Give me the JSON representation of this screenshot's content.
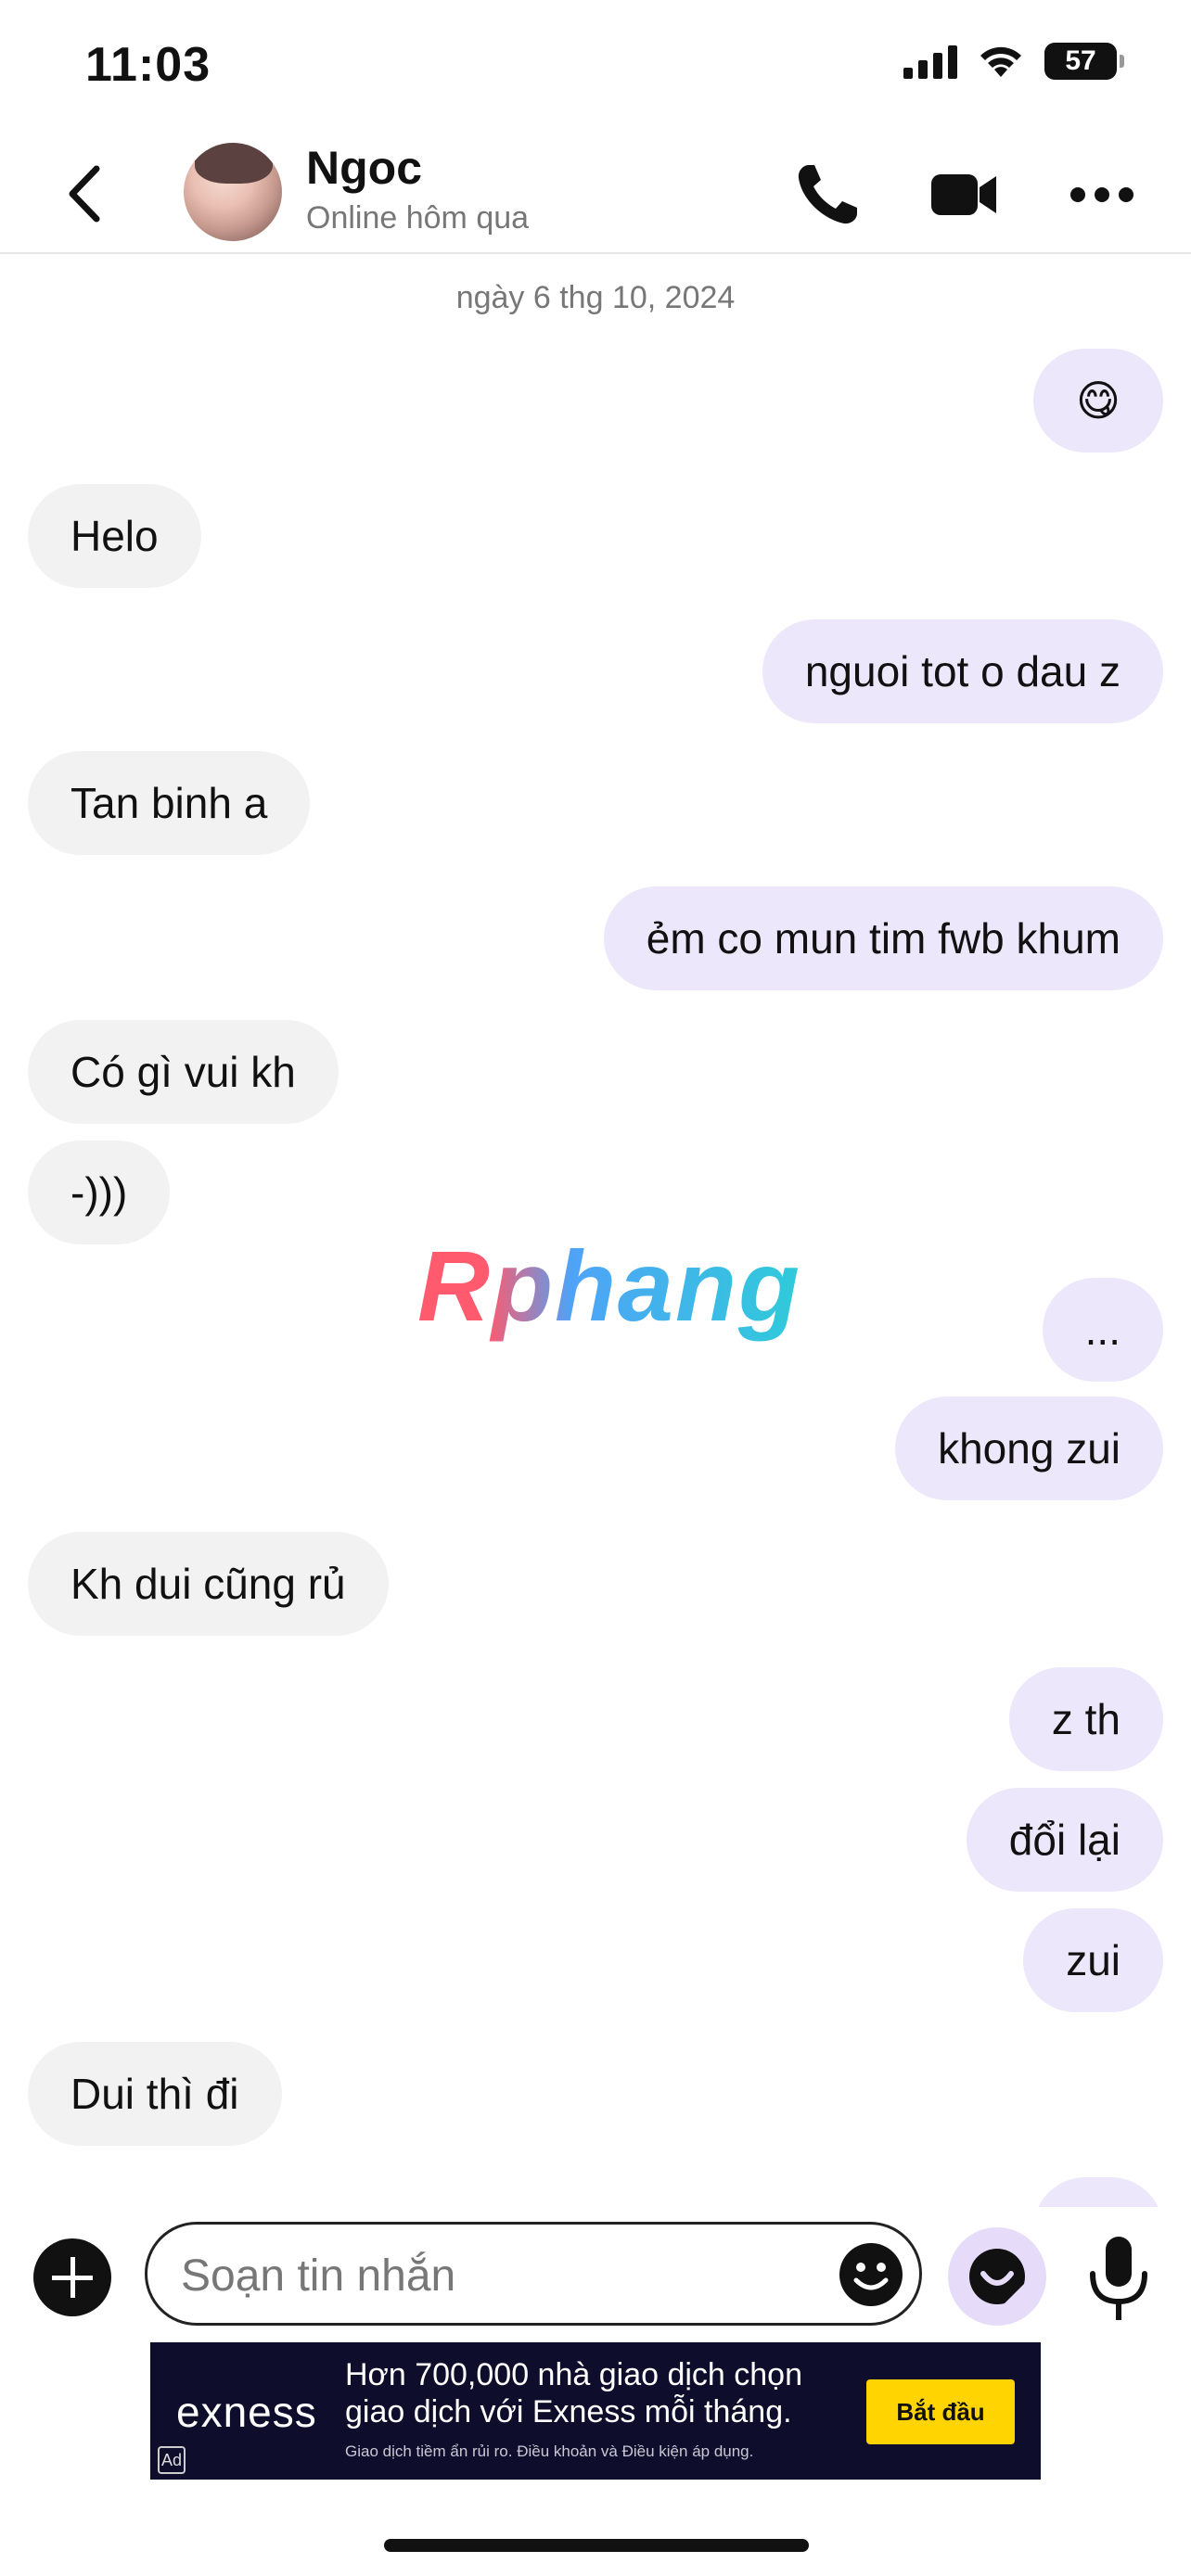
{
  "status_bar": {
    "time": "11:03",
    "battery": "57"
  },
  "header": {
    "contact_name": "Ngoc",
    "contact_status": "Online hôm qua"
  },
  "chat": {
    "date_separator": "ngày 6 thg 10, 2024",
    "messages": [
      {
        "from": "me",
        "text": "😋"
      },
      {
        "from": "them",
        "text": "Helo"
      },
      {
        "from": "me",
        "text": "nguoi tot o dau z"
      },
      {
        "from": "them",
        "text": "Tan binh a"
      },
      {
        "from": "me",
        "text": "ẻm co mun tim fwb khum"
      },
      {
        "from": "them",
        "text": "Có gì vui kh"
      },
      {
        "from": "them",
        "text": "-)))"
      },
      {
        "from": "me",
        "text": "..."
      },
      {
        "from": "me",
        "text": "khong zui"
      },
      {
        "from": "them",
        "text": "Kh dui cũng rủ"
      },
      {
        "from": "me",
        "text": "z th"
      },
      {
        "from": "me",
        "text": "đổi lại"
      },
      {
        "from": "me",
        "text": "zui"
      },
      {
        "from": "them",
        "text": "Dui thì đi"
      }
    ],
    "watermark": "Rphang"
  },
  "composer": {
    "placeholder": "Soạn tin nhắn",
    "value": ""
  },
  "ad": {
    "brand": "exness",
    "line1": "Hơn 700,000 nhà giao dịch chọn",
    "line2": "giao dịch với Exness mỗi tháng.",
    "disclaimer": "Giao dịch tiềm ẩn rủi ro. Điều khoản và Điều kiện áp dụng.",
    "badge": "Ad",
    "cta": "Bắt đầu"
  },
  "colors": {
    "incoming_bubble": "#f2f2f2",
    "outgoing_bubble": "#ede7fb",
    "ad_background": "#0e0e2c",
    "ad_cta": "#ffd400"
  },
  "icons": [
    "back-icon",
    "phone-icon",
    "video-icon",
    "more-icon",
    "plus-icon",
    "emoji-icon",
    "sticker-icon",
    "mic-icon"
  ]
}
